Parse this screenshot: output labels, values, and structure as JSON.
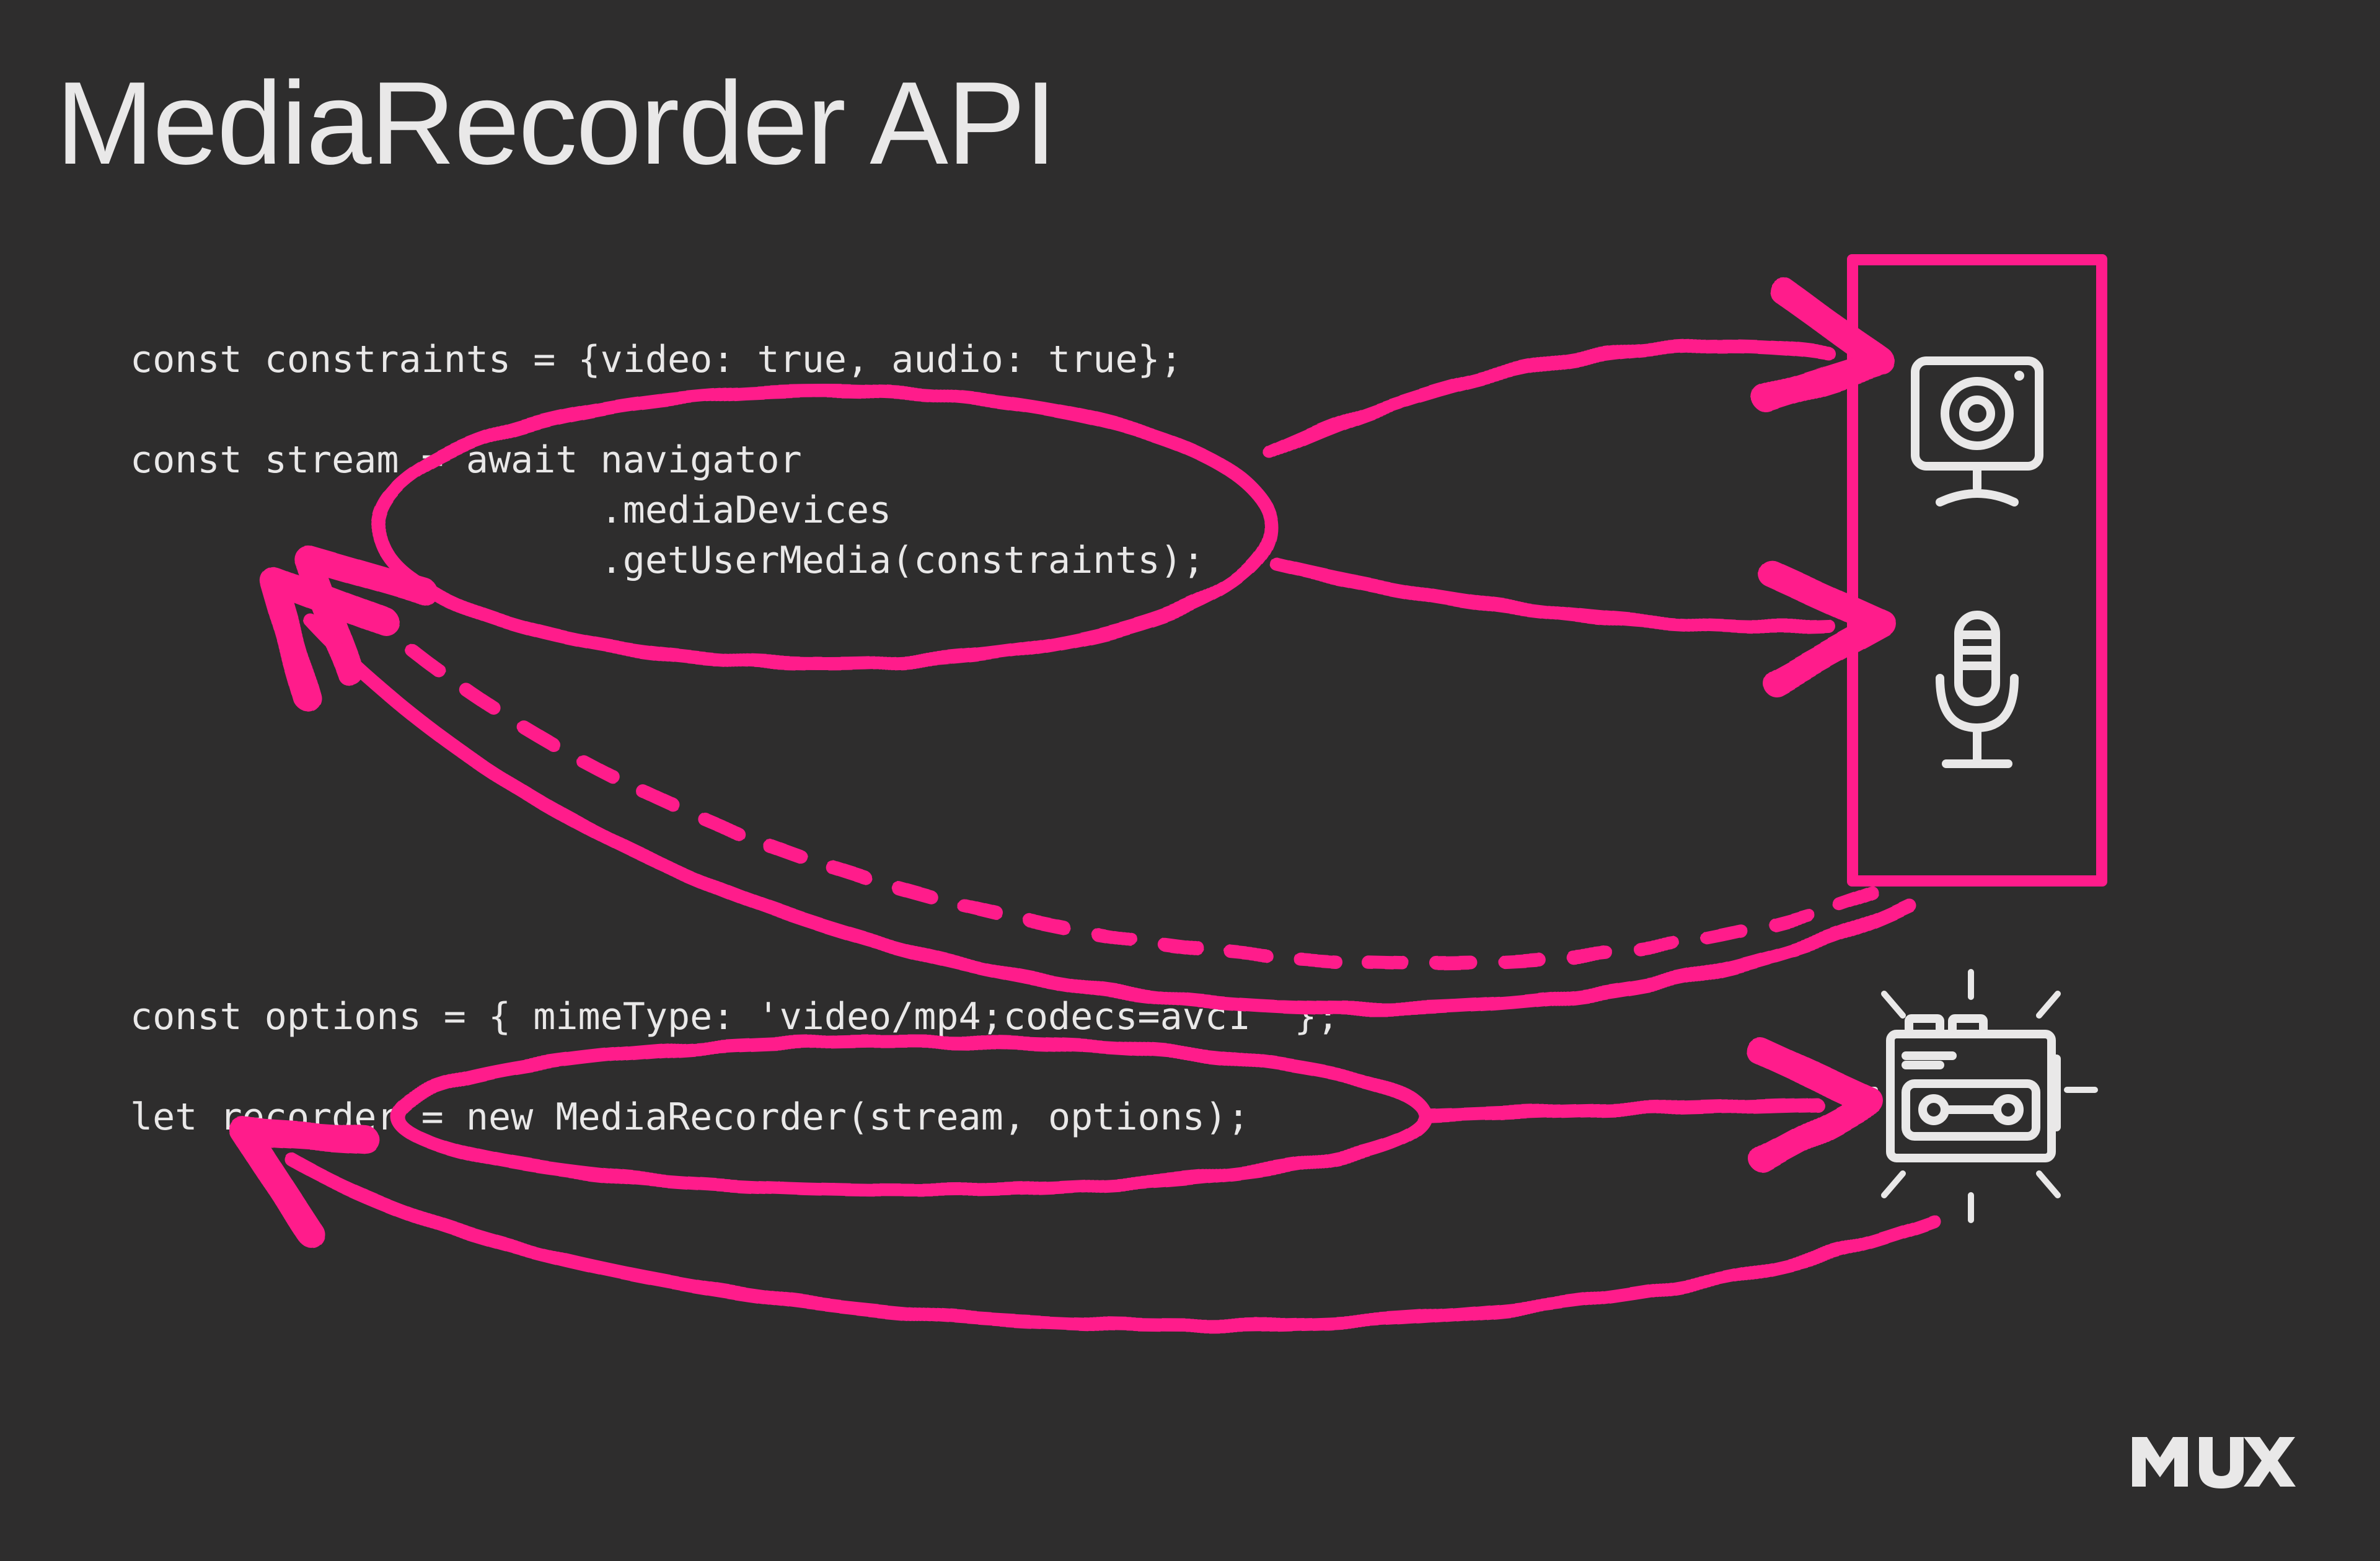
{
  "title": "MediaRecorder API",
  "code_block_1": "const constraints = {video: true, audio: true};\n\nconst stream = await navigator\n                     .mediaDevices\n                     .getUserMedia(constraints);",
  "code_block_2": "const options = { mimeType: 'video/mp4;codecs=avc1' };\n\nlet recorder = new MediaRecorder(stream, options);",
  "brand": "MUX",
  "accent_color": "#ff1c8b",
  "icons": {
    "webcam": "webcam-icon",
    "microphone": "microphone-icon",
    "tape_recorder": "tape-recorder-icon"
  },
  "annotations": [
    "circle around getUserMedia call",
    "arrow from getUserMedia to webcam",
    "arrow from getUserMedia to microphone",
    "dashed arrow from devices box back to stream variable",
    "circle around new MediaRecorder call",
    "arrow from MediaRecorder to tape recorder icon",
    "arrow from tape recorder back to recorder variable"
  ]
}
